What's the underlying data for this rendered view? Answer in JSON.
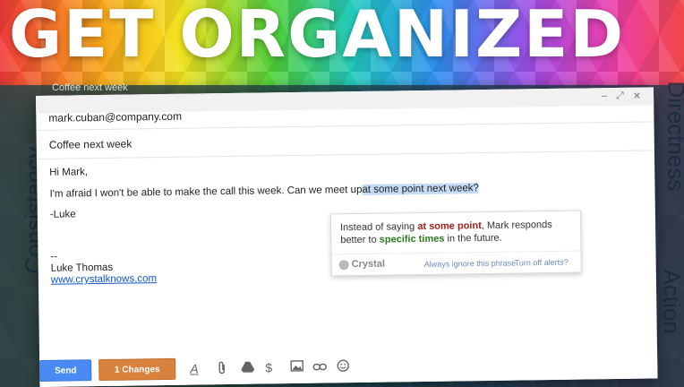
{
  "headline": "GET ORGANIZED",
  "side_words": {
    "left": "Consistancy",
    "right_top": "Directness",
    "right_bottom": "Action"
  },
  "background_window_title": "Coffee next week",
  "email": {
    "to": "mark.cuban@company.com",
    "subject": "Coffee next week",
    "greeting": "Hi Mark,",
    "line1_before": "I'm afraid I won't be able to make the call this week. Can we meet up",
    "line1_highlight": "at some point next week?",
    "signoff": "-Luke",
    "sig_dashes": "--",
    "sig_name": "Luke Thomas",
    "sig_link": "www.crystalknows.com"
  },
  "window_controls": {
    "minimize": "–",
    "popout": "⤢",
    "close": "✕"
  },
  "popup": {
    "msg_part1": "Instead of saying ",
    "keyword_red": "at some point",
    "msg_part2": ", Mark responds better to ",
    "keyword_green": "specific times",
    "msg_part3": " in the future.",
    "brand": "Crystal",
    "link_ignore": "Always ignore this phrase",
    "link_turnoff": "Turn off alerts?"
  },
  "toolbar": {
    "send_label": "Send",
    "changes_label": "1 Changes",
    "icons": [
      "format-text-icon",
      "attach-icon",
      "drive-icon",
      "money-icon",
      "photo-icon",
      "link-icon",
      "emoji-icon"
    ]
  },
  "colors": {
    "send_button": "#4a8af4",
    "changes_button": "#d9823d",
    "highlight": "#c5dcf7",
    "keyword_red": "#a32020",
    "keyword_green": "#2c7a1e"
  }
}
